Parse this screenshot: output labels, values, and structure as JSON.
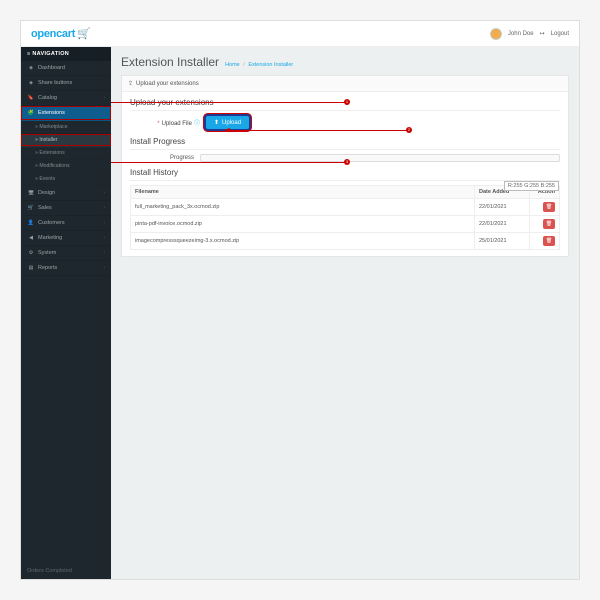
{
  "brand": "opencart",
  "user": {
    "name": "John Doe",
    "logout": "Logout"
  },
  "nav": {
    "title": "NAVIGATION",
    "items": [
      {
        "label": "Dashboard",
        "icon": "◈"
      },
      {
        "label": "Share buttons",
        "icon": "◈"
      },
      {
        "label": "Catalog",
        "icon": "🔖"
      },
      {
        "label": "Extensions",
        "icon": "🧩",
        "active": true
      },
      {
        "label": "Design",
        "icon": "🖥"
      },
      {
        "label": "Sales",
        "icon": "🛒"
      },
      {
        "label": "Customers",
        "icon": "👤"
      },
      {
        "label": "Marketing",
        "icon": "◀"
      },
      {
        "label": "System",
        "icon": "⚙"
      },
      {
        "label": "Reports",
        "icon": "▤"
      }
    ],
    "subs": [
      {
        "label": "Marketplace"
      },
      {
        "label": "Installer",
        "hl": true
      },
      {
        "label": "Extensions"
      },
      {
        "label": "Modifications"
      },
      {
        "label": "Events"
      }
    ],
    "footer": "Orders Completed"
  },
  "page": {
    "title": "Extension Installer",
    "crumb_home": "Home",
    "crumb_page": "Extension Installer"
  },
  "panel": {
    "header": "Upload your extensions",
    "section1": "Upload your extensions",
    "form_label": "Upload File",
    "upload_btn": "Upload",
    "section2": "Install Progress",
    "progress_label": "Progress",
    "section3": "Install History"
  },
  "rgb_readout": "R:255 G:255 B:255",
  "table": {
    "cols": {
      "filename": "Filename",
      "date": "Date Added",
      "action": "Action"
    },
    "rows": [
      {
        "filename": "full_marketing_pack_3x.ocmod.zip",
        "date": "22/01/2021"
      },
      {
        "filename": "pinta-pdf-invoice.ocmod.zip",
        "date": "22/01/2021"
      },
      {
        "filename": "imagecompresssqueezeimg-3.x.ocmod.zip",
        "date": "25/01/2021"
      }
    ]
  },
  "markers": {
    "m1": "1",
    "m2": "2",
    "m3": "3"
  }
}
